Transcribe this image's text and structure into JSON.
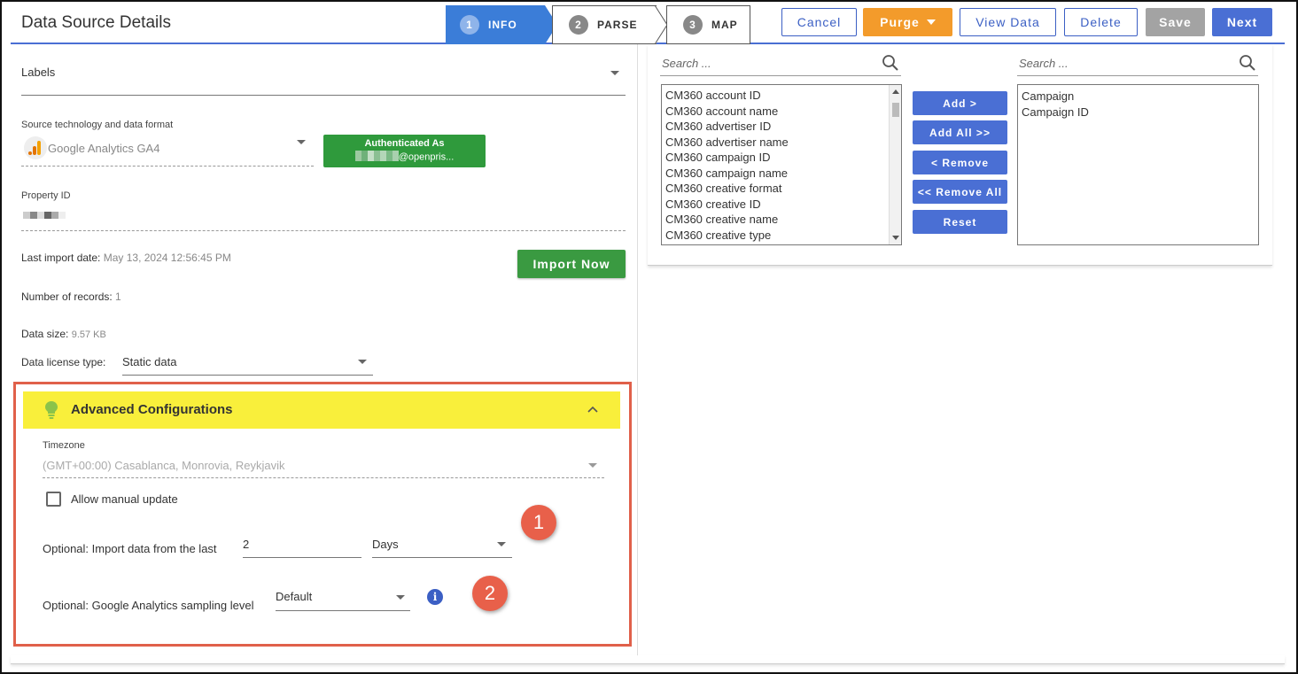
{
  "header": {
    "title": "Data Source Details",
    "steps": [
      {
        "num": "1",
        "label": "INFO"
      },
      {
        "num": "2",
        "label": "PARSE"
      },
      {
        "num": "3",
        "label": "MAP"
      }
    ],
    "buttons": {
      "cancel": "Cancel",
      "purge": "Purge",
      "view_data": "View Data",
      "delete": "Delete",
      "save": "Save",
      "next": "Next"
    }
  },
  "left": {
    "labels_field": "Labels",
    "source_tech_label": "Source technology and data format",
    "source_tech_value": "Google Analytics GA4",
    "auth": {
      "title": "Authenticated As",
      "email": "@openpris..."
    },
    "property_id_label": "Property ID",
    "last_import_label": "Last import date:",
    "last_import_value": "May 13, 2024 12:56:45 PM",
    "import_now": "Import Now",
    "records_label": "Number of records:",
    "records_value": "1",
    "size_label": "Data size:",
    "size_value": "9.57 KB",
    "license_label": "Data license type:",
    "license_value": "Static data",
    "advanced": {
      "title": "Advanced Configurations",
      "timezone_label": "Timezone",
      "timezone_value": "(GMT+00:00) Casablanca, Monrovia, Reykjavik",
      "allow_manual": "Allow manual update",
      "import_last_label": "Optional: Import data from the last",
      "import_last_value": "2",
      "import_last_unit": "Days",
      "sampling_label": "Optional: Google Analytics sampling level",
      "sampling_value": "Default",
      "badge1": "1",
      "badge2": "2",
      "info": "i"
    }
  },
  "right": {
    "search_placeholder": "Search ...",
    "available": [
      "CM360 account ID",
      "CM360 account name",
      "CM360 advertiser ID",
      "CM360 advertiser name",
      "CM360 campaign ID",
      "CM360 campaign name",
      "CM360 creative format",
      "CM360 creative ID",
      "CM360 creative name",
      "CM360 creative type"
    ],
    "selected": [
      "Campaign",
      "Campaign ID"
    ],
    "buttons": {
      "add": "Add >",
      "add_all": "Add All >>",
      "remove": "< Remove",
      "remove_all": "<< Remove All",
      "reset": "Reset"
    }
  },
  "colors": {
    "primary": "#4a6fd4",
    "step_active": "#3b7dd8",
    "purge": "#f39b2b",
    "green": "#2f9a3c",
    "highlight": "#f9ef3b",
    "annotation": "#e8604a"
  }
}
